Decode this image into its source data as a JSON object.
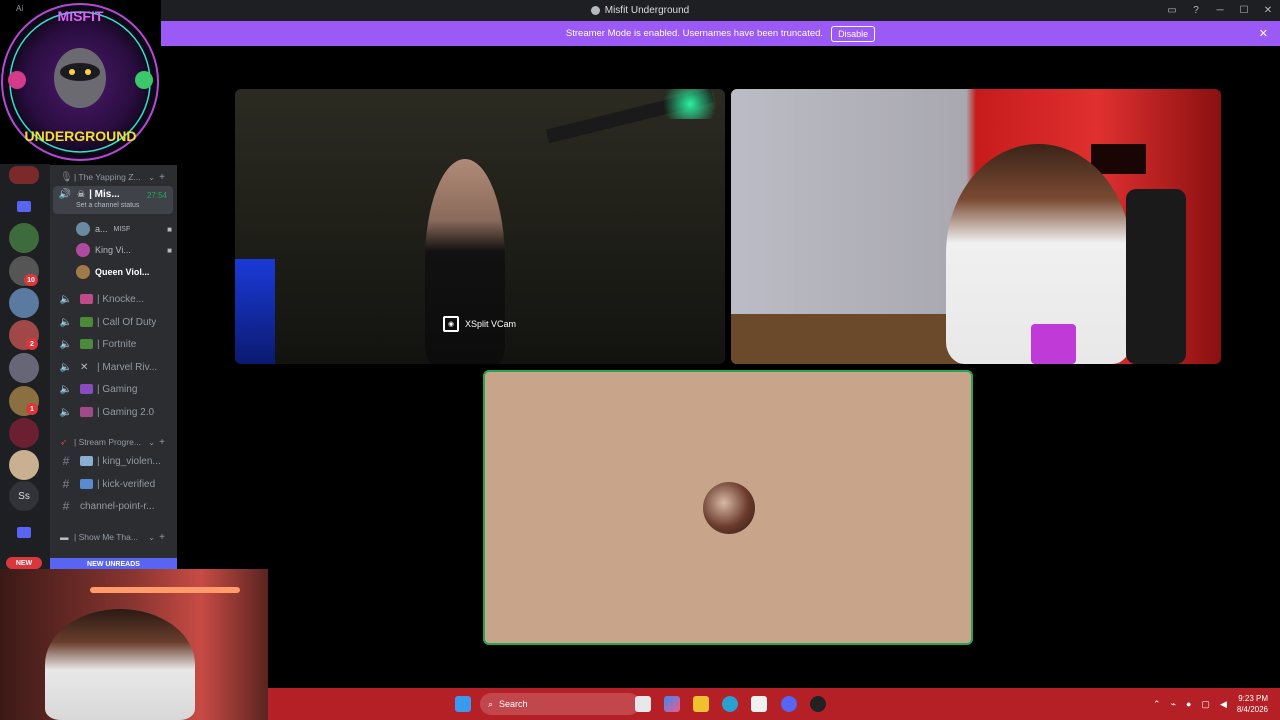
{
  "titlebar": {
    "corner_label": "Ai",
    "title": "Misfit Underground"
  },
  "notice": {
    "message": "Streamer Mode is enabled. Usernames have been truncated.",
    "disable_label": "Disable"
  },
  "logo": {
    "line1": "MISFIT",
    "line2": "UNDERGROUND"
  },
  "rail": {
    "badges": [
      "10",
      "2",
      "1"
    ],
    "text_server": "Ss",
    "new_label": "NEW"
  },
  "channels": {
    "category_yapping": "| The Yapping Z...",
    "active_channel": "| Mis...",
    "active_timer": "27:54",
    "active_status": "Set a channel status",
    "users": [
      {
        "name": "a...",
        "extra": "MISF"
      },
      {
        "name": "King Vi..."
      },
      {
        "name": "Queen Viol..."
      }
    ],
    "voice": [
      {
        "label": "| Knocke..."
      },
      {
        "label": "| Call Of Duty"
      },
      {
        "label": "| Fortnite"
      },
      {
        "label": "| Marvel Riv..."
      },
      {
        "label": "| Gaming"
      },
      {
        "label": "| Gaming 2.0"
      }
    ],
    "category_stream": "| Stream Progre...",
    "text_channels": [
      {
        "label": "| king_violen..."
      },
      {
        "label": "| kick-verified"
      },
      {
        "label": "channel-point-r..."
      }
    ],
    "category_show": "| Show Me Tha...",
    "new_unreads": "NEW UNREADS"
  },
  "stream": {
    "vcam_label": "XSplit VCam"
  },
  "taskbar": {
    "search_label": "Search",
    "time": "9:23 PM",
    "date": "8/4/2026"
  }
}
